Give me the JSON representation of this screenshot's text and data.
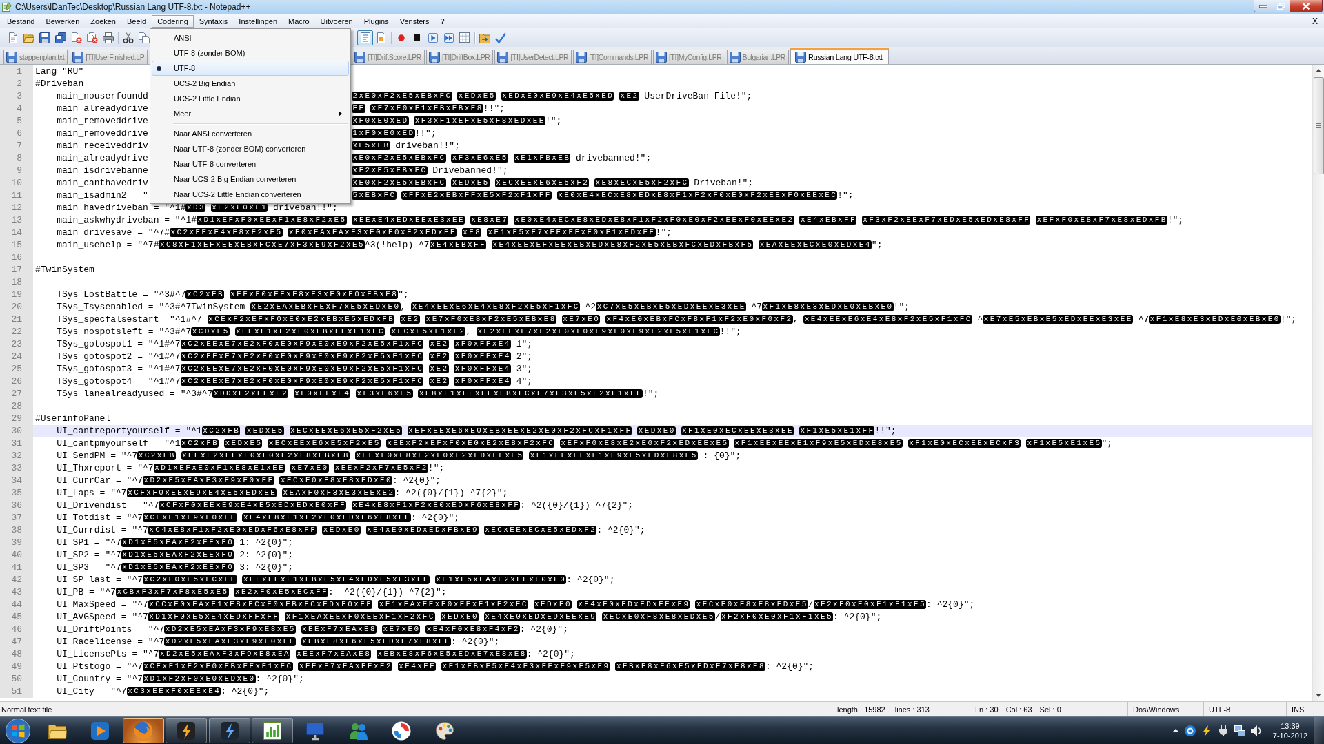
{
  "window": {
    "title": "C:\\Users\\IDanTec\\Desktop\\Russian Lang UTF-8.txt - Notepad++"
  },
  "menu_bar": {
    "items": [
      {
        "label": "Bestand",
        "selected": false
      },
      {
        "label": "Bewerken",
        "selected": false
      },
      {
        "label": "Zoeken",
        "selected": false
      },
      {
        "label": "Beeld",
        "selected": false
      },
      {
        "label": "Codering",
        "selected": true
      },
      {
        "label": "Syntaxis",
        "selected": false
      },
      {
        "label": "Instellingen",
        "selected": false
      },
      {
        "label": "Macro",
        "selected": false
      },
      {
        "label": "Uitvoeren",
        "selected": false
      },
      {
        "label": "Plugins",
        "selected": false
      },
      {
        "label": "Vensters",
        "selected": false
      },
      {
        "label": "?",
        "selected": false
      }
    ],
    "close_label": "X"
  },
  "toolbar": {
    "before_menu": [
      [
        {
          "kind": "new",
          "pressed": false
        },
        {
          "kind": "open",
          "pressed": false
        },
        {
          "kind": "save",
          "pressed": false
        },
        {
          "kind": "save_all",
          "pressed": false
        },
        {
          "kind": "close",
          "pressed": false
        },
        {
          "kind": "close_all",
          "pressed": false
        },
        {
          "kind": "print",
          "pressed": false
        }
      ],
      [
        {
          "kind": "cut",
          "pressed": false
        },
        {
          "kind": "copy",
          "pressed": false
        }
      ]
    ],
    "after_menu": [
      [
        {
          "kind": "wrap",
          "pressed": true
        },
        {
          "kind": "document",
          "pressed": false
        }
      ],
      [
        {
          "kind": "record",
          "pressed": false
        },
        {
          "kind": "stop",
          "pressed": false
        },
        {
          "kind": "play",
          "pressed": false
        },
        {
          "kind": "play_repeat",
          "pressed": false
        },
        {
          "kind": "save_macro",
          "pressed": false
        }
      ],
      [
        {
          "kind": "folder_run",
          "pressed": false
        },
        {
          "kind": "spell_check",
          "pressed": false
        }
      ]
    ]
  },
  "tabs": {
    "before_menu": [
      {
        "label": "stappenplan.txt",
        "selected": false
      },
      {
        "label": "[TI]UserFinished.LP",
        "selected": false
      }
    ],
    "after_menu": [
      {
        "label": "[TI]DriftScore.LPR",
        "selected": false
      },
      {
        "label": "[TI]DriftBox.LPR",
        "selected": false
      },
      {
        "label": "[TI]UserDetect.LPR",
        "selected": false
      },
      {
        "label": "[TI]Commands.LPR",
        "selected": false
      },
      {
        "label": "[TI]MyConfig.LPR",
        "selected": false
      },
      {
        "label": "Bulgarian.LPR",
        "selected": false
      },
      {
        "label": "Russian Lang UTF-8.txt",
        "selected": true
      }
    ]
  },
  "editor": {
    "lines": [
      {
        "number": "1",
        "current": false,
        "segments": [
          {
            "kind": "text",
            "text": "Lang \"RU\""
          }
        ]
      },
      {
        "number": "2",
        "current": false,
        "segments": [
          {
            "kind": "text",
            "text": "#Driveban"
          }
        ]
      },
      {
        "number": "3",
        "current": false,
        "segments": [
          {
            "kind": "text",
            "text": "    main_nouserfoundd"
          }
        ],
        "after_menu": [
          {
            "kind": "bytes",
            "text": "2xE0xF2xE5xEBxFC xEDxE5 xEDxE0xE9xE4xE5xED xE2"
          },
          {
            "kind": "text",
            "text": " UserDriveBan File!\";"
          }
        ]
      },
      {
        "number": "4",
        "current": false,
        "segments": [
          {
            "kind": "text",
            "text": "    main_alreadydrive"
          }
        ],
        "after_menu": [
          {
            "kind": "bytes",
            "text": "EE xE7xE0xE1xFBxEBxE8"
          },
          {
            "kind": "text",
            "text": "!!\";"
          }
        ]
      },
      {
        "number": "5",
        "current": false,
        "segments": [
          {
            "kind": "text",
            "text": "    main_removeddrive"
          }
        ],
        "after_menu": [
          {
            "kind": "bytes",
            "text": "xF0xE0xED xF3xF1xEFxE5xF8xEDxEE"
          },
          {
            "kind": "text",
            "text": "!\";"
          }
        ]
      },
      {
        "number": "6",
        "current": false,
        "segments": [
          {
            "kind": "text",
            "text": "    main_removeddrive"
          }
        ],
        "after_menu": [
          {
            "kind": "bytes",
            "text": "1xF0xE0xED"
          },
          {
            "kind": "text",
            "text": "!!\";"
          }
        ]
      },
      {
        "number": "7",
        "current": false,
        "segments": [
          {
            "kind": "text",
            "text": "    main_receiveddriv"
          }
        ],
        "after_menu": [
          {
            "kind": "bytes",
            "text": "xE5xEB"
          },
          {
            "kind": "text",
            "text": " driveban!!\";"
          }
        ]
      },
      {
        "number": "8",
        "current": false,
        "segments": [
          {
            "kind": "text",
            "text": "    main_alreadydrive"
          }
        ],
        "after_menu": [
          {
            "kind": "bytes",
            "text": "xE0xF2xE5xEBxFC xF3xE6xE5 xE1xFBxEB"
          },
          {
            "kind": "text",
            "text": " drivebanned!\";"
          }
        ]
      },
      {
        "number": "9",
        "current": false,
        "segments": [
          {
            "kind": "text",
            "text": "    main_isdrivebanne"
          }
        ],
        "after_menu": [
          {
            "kind": "bytes",
            "text": "xF2xE5xEBxFC"
          },
          {
            "kind": "text",
            "text": " Drivebanned!\";"
          }
        ]
      },
      {
        "number": "10",
        "current": false,
        "segments": [
          {
            "kind": "text",
            "text": "    main_canthavedriv"
          }
        ],
        "after_menu": [
          {
            "kind": "bytes",
            "text": "xE0xF2xE5xEBxFC xEDxE5 xECxEExE6xE5xF2 xE8xECxE5xF2xFC"
          },
          {
            "kind": "text",
            "text": " Driveban!\";"
          }
        ]
      },
      {
        "number": "11",
        "current": false,
        "segments": [
          {
            "kind": "text",
            "text": "    main_isadmin2 = \""
          }
        ],
        "after_menu": [
          {
            "kind": "bytes",
            "text": "5xEBxFC xFFxE2xEBxFFxE5xF2xF1xFF xE0xE4xECxE8xEDxE8xF1xF2xF0xE0xF2xEExF0xEExEC"
          },
          {
            "kind": "text",
            "text": "!\";"
          }
        ]
      },
      {
        "number": "12",
        "current": false,
        "segments": [
          {
            "kind": "text",
            "text": "    main_havedriveban = \"^1#"
          },
          {
            "kind": "bytes",
            "text": "xD3 xE2xE0xF1"
          },
          {
            "kind": "text",
            "text": " driveban!!\";"
          }
        ]
      },
      {
        "number": "13",
        "current": false,
        "segments": [
          {
            "kind": "text",
            "text": "    main_askwhydriveban = \"^1#"
          },
          {
            "kind": "bytes",
            "text": "xD1xEFxF0xEExF1xE8xF2xE5 xEExE4xEDxEExE3xEE xE8xE7 xE0xE4xECxE8xEDxE8xF1xF2xF0xE0xF2xEExF0xEExE2 xE4xEBxFF xF3xF2xEExF7xEDxE5xEDxE8xFF xEFxF0xE8xF7xE8xEDxFB"
          },
          {
            "kind": "text",
            "text": "!\";"
          }
        ]
      },
      {
        "number": "14",
        "current": false,
        "segments": [
          {
            "kind": "text",
            "text": "    main_drivesave = \"^7#"
          },
          {
            "kind": "bytes",
            "text": "xC2xEExE4xE8xF2xE5 xE0xEAxEAxF3xF0xE0xF2xEDxEE xE8 xE1xE5xE7xEExEFxE0xF1xEDxEE"
          },
          {
            "kind": "text",
            "text": "!\";"
          }
        ]
      },
      {
        "number": "15",
        "current": false,
        "segments": [
          {
            "kind": "text",
            "text": "    main_usehelp = \"^7#"
          },
          {
            "kind": "bytes",
            "text": "xC8xF1xEFxEExEBxFCxE7xF3xE9xF2xE5"
          },
          {
            "kind": "text",
            "text": "^3(!help) ^7"
          },
          {
            "kind": "bytes",
            "text": "xE4xEBxFF xE4xEExEFxEExEBxEDxE8xF2xE5xEBxFCxEDxFBxF5 xEAxEExECxE0xEDxE4"
          },
          {
            "kind": "text",
            "text": "\";"
          }
        ]
      },
      {
        "number": "16",
        "current": false
      },
      {
        "number": "17",
        "current": false,
        "segments": [
          {
            "kind": "text",
            "text": "#TwinSystem"
          }
        ]
      },
      {
        "number": "18",
        "current": false
      },
      {
        "number": "19",
        "current": false,
        "segments": [
          {
            "kind": "text",
            "text": "    TSys_LostBattle = \"^3#^7"
          },
          {
            "kind": "bytes",
            "text": "xC2xFB xEFxF0xEExE8xE3xF0xE0xEBxE8"
          },
          {
            "kind": "text",
            "text": "\";"
          }
        ]
      },
      {
        "number": "20",
        "current": false,
        "segments": [
          {
            "kind": "text",
            "text": "    TSys_Tsysenabled = \"^3#^7TwinSystem "
          },
          {
            "kind": "bytes",
            "text": "xE2xEAxEBxFExF7xE5xEDxE0"
          },
          {
            "kind": "text",
            "text": ", "
          },
          {
            "kind": "bytes",
            "text": "xE4xEExE6xE4xE8xF2xE5xF1xFC"
          },
          {
            "kind": "text",
            "text": " ^2"
          },
          {
            "kind": "bytes",
            "text": "xC7xE5xEBxE5xEDxEExE3xEE"
          },
          {
            "kind": "text",
            "text": " ^7"
          },
          {
            "kind": "bytes",
            "text": "xF1xE8xE3xEDxE0xEBxE0"
          },
          {
            "kind": "text",
            "text": "!\";"
          }
        ]
      },
      {
        "number": "21",
        "current": false,
        "segments": [
          {
            "kind": "text",
            "text": "    TSys_specfalsestart =\"^1#^7 "
          },
          {
            "kind": "bytes",
            "text": "xCExF2xEFxF0xE0xE2xEBxE5xEDxFB xE2 xE7xF0xE8xF2xE5xEBxE8 xE7xE0 xF4xE0xEBxFCxF8xF1xF2xE0xF0xF2"
          },
          {
            "kind": "text",
            "text": ", "
          },
          {
            "kind": "bytes",
            "text": "xE4xEExE6xE4xE8xF2xE5xF1xFC"
          },
          {
            "kind": "text",
            "text": " ^"
          },
          {
            "kind": "bytes",
            "text": "xE7xE5xEBxE5xEDxEExE3xEE"
          },
          {
            "kind": "text",
            "text": " ^7"
          },
          {
            "kind": "bytes",
            "text": "xF1xE8xE3xEDxE0xEBxE0"
          },
          {
            "kind": "text",
            "text": "!\";"
          }
        ]
      },
      {
        "number": "22",
        "current": false,
        "segments": [
          {
            "kind": "text",
            "text": "    TSys_nospotsleft = \"^3#^7"
          },
          {
            "kind": "bytes",
            "text": "xCDxE5 xEExF1xF2xE0xEBxEExF1xFC xECxE5xF1xF2"
          },
          {
            "kind": "text",
            "text": ", "
          },
          {
            "kind": "bytes",
            "text": "xE2xEExE7xE2xF0xE0xF9xE0xE9xF2xE5xF1xFC"
          },
          {
            "kind": "text",
            "text": "!!\";"
          }
        ]
      },
      {
        "number": "23",
        "current": false,
        "segments": [
          {
            "kind": "text",
            "text": "    TSys_gotospot1 = \"^1#^7"
          },
          {
            "kind": "bytes",
            "text": "xC2xEExE7xE2xF0xE0xF9xE0xE9xF2xE5xF1xFC xE2 xF0xFFxE4"
          },
          {
            "kind": "text",
            "text": " 1\";"
          }
        ]
      },
      {
        "number": "24",
        "current": false,
        "segments": [
          {
            "kind": "text",
            "text": "    TSys_gotospot2 = \"^1#^7"
          },
          {
            "kind": "bytes",
            "text": "xC2xEExE7xE2xF0xE0xF9xE0xE9xF2xE5xF1xFC xE2 xF0xFFxE4"
          },
          {
            "kind": "text",
            "text": " 2\";"
          }
        ]
      },
      {
        "number": "25",
        "current": false,
        "segments": [
          {
            "kind": "text",
            "text": "    TSys_gotospot3 = \"^1#^7"
          },
          {
            "kind": "bytes",
            "text": "xC2xEExE7xE2xF0xE0xF9xE0xE9xF2xE5xF1xFC xE2 xF0xFFxE4"
          },
          {
            "kind": "text",
            "text": " 3\";"
          }
        ]
      },
      {
        "number": "26",
        "current": false,
        "segments": [
          {
            "kind": "text",
            "text": "    TSys_gotospot4 = \"^1#^7"
          },
          {
            "kind": "bytes",
            "text": "xC2xEExE7xE2xF0xE0xF9xE0xE9xF2xE5xF1xFC xE2 xF0xFFxE4"
          },
          {
            "kind": "text",
            "text": " 4\";"
          }
        ]
      },
      {
        "number": "27",
        "current": false,
        "segments": [
          {
            "kind": "text",
            "text": "    TSys_lanealreadyused = \"^3#^7"
          },
          {
            "kind": "bytes",
            "text": "xDDxF2xEExF2 xF0xFFxE4 xF3xE6xE5 xE8xF1xEFxEExEBxFCxE7xF3xE5xF2xF1xFF"
          },
          {
            "kind": "text",
            "text": "!\";"
          }
        ]
      },
      {
        "number": "28",
        "current": false
      },
      {
        "number": "29",
        "current": false,
        "segments": [
          {
            "kind": "text",
            "text": "#UserinfoPanel"
          }
        ]
      },
      {
        "number": "30",
        "current": true,
        "segments": [
          {
            "kind": "text",
            "text": "    UI_cantreportyourself = \"^1"
          },
          {
            "kind": "bytes",
            "text": "xC2xFB xEDxE5 xECxEExE6xE5xF2xE5 xEFxEExE6xE0xEBxEExE2xE0xF2xFCxF1xFF xEDxE0 xF1xE0xECxEExE3xEE xF1xE5xE1xFF"
          },
          {
            "kind": "text",
            "text": "!!\";"
          }
        ]
      },
      {
        "number": "31",
        "current": false,
        "segments": [
          {
            "kind": "text",
            "text": "    UI_cantpmyourself = \"^1"
          },
          {
            "kind": "bytes",
            "text": "xC2xFB xEDxE5 xECxEExE6xE5xF2xE5 xEExF2xEFxF0xE0xE2xE8xF2xFC xEFxF0xE8xE2xE0xF2xEDxEExE5 xF1xEExEExE1xF9xE5xEDxE8xE5 xF1xE0xECxEExECxF3 xF1xE5xE1xE5"
          },
          {
            "kind": "text",
            "text": "\";"
          }
        ]
      },
      {
        "number": "32",
        "current": false,
        "segments": [
          {
            "kind": "text",
            "text": "    UI_SendPM = \"^7"
          },
          {
            "kind": "bytes",
            "text": "xC2xFB xEExF2xEFxF0xE0xE2xE8xEBxE8 xEFxF0xE8xE2xE0xF2xEDxEExE5 xF1xEExEExE1xF9xE5xEDxE8xE5"
          },
          {
            "kind": "text",
            "text": " : {0}\";"
          }
        ]
      },
      {
        "number": "33",
        "current": false,
        "segments": [
          {
            "kind": "text",
            "text": "    UI_Thxreport = \"^7"
          },
          {
            "kind": "bytes",
            "text": "xD1xEFxE0xF1xE8xE1xEE xE7xE0 xEExF2xF7xE5xF2"
          },
          {
            "kind": "text",
            "text": "!\";"
          }
        ]
      },
      {
        "number": "34",
        "current": false,
        "segments": [
          {
            "kind": "text",
            "text": "    UI_CurrCar = \"^7"
          },
          {
            "kind": "bytes",
            "text": "xD2xE5xEAxF3xF9xE0xFF xECxE0xF8xE8xEDxE0"
          },
          {
            "kind": "text",
            "text": ": ^2{0}\";"
          }
        ]
      },
      {
        "number": "35",
        "current": false,
        "segments": [
          {
            "kind": "text",
            "text": "    UI_Laps = \"^7"
          },
          {
            "kind": "bytes",
            "text": "xCFxF0xEExE9xE4xE5xEDxEE xEAxF0xF3xE3xEExE2"
          },
          {
            "kind": "text",
            "text": ": ^2({0}/{1}) ^7{2}\";"
          }
        ]
      },
      {
        "number": "36",
        "current": false,
        "segments": [
          {
            "kind": "text",
            "text": "    UI_Drivendist = \"^7"
          },
          {
            "kind": "bytes",
            "text": "xCFxF0xEExE9xE4xE5xEDxEDxE0xFF xE4xE8xF1xF2xE0xEDxF6xE8xFF"
          },
          {
            "kind": "text",
            "text": ": ^2({0}/{1}) ^7{2}\";"
          }
        ]
      },
      {
        "number": "37",
        "current": false,
        "segments": [
          {
            "kind": "text",
            "text": "    UI_Totdist = \"^7"
          },
          {
            "kind": "bytes",
            "text": "xCExE1xF9xE0xFF xE4xE8xF1xF2xE0xEDxF6xE8xFF"
          },
          {
            "kind": "text",
            "text": ": ^2{0}\";"
          }
        ]
      },
      {
        "number": "38",
        "current": false,
        "segments": [
          {
            "kind": "text",
            "text": "    UI_Currdist = \"^7"
          },
          {
            "kind": "bytes",
            "text": "xC4xE8xF1xF2xE0xEDxF6xE8xFF xEDxE0 xE4xE0xEDxEDxFBxE9 xECxEExECxE5xEDxF2"
          },
          {
            "kind": "text",
            "text": ": ^2{0}\";"
          }
        ]
      },
      {
        "number": "39",
        "current": false,
        "segments": [
          {
            "kind": "text",
            "text": "    UI_SP1 = \"^7"
          },
          {
            "kind": "bytes",
            "text": "xD1xE5xEAxF2xEExF0"
          },
          {
            "kind": "text",
            "text": " 1: ^2{0}\";"
          }
        ]
      },
      {
        "number": "40",
        "current": false,
        "segments": [
          {
            "kind": "text",
            "text": "    UI_SP2 = \"^7"
          },
          {
            "kind": "bytes",
            "text": "xD1xE5xEAxF2xEExF0"
          },
          {
            "kind": "text",
            "text": " 2: ^2{0}\";"
          }
        ]
      },
      {
        "number": "41",
        "current": false,
        "segments": [
          {
            "kind": "text",
            "text": "    UI_SP3 = \"^7"
          },
          {
            "kind": "bytes",
            "text": "xD1xE5xEAxF2xEExF0"
          },
          {
            "kind": "text",
            "text": " 3: ^2{0}\";"
          }
        ]
      },
      {
        "number": "42",
        "current": false,
        "segments": [
          {
            "kind": "text",
            "text": "    UI_SP_last = \"^7"
          },
          {
            "kind": "bytes",
            "text": "xC2xF0xE5xECxFF xEFxEExF1xEBxE5xE4xEDxE5xE3xEE xF1xE5xEAxF2xEExF0xE0"
          },
          {
            "kind": "text",
            "text": ": ^2{0}\";"
          }
        ]
      },
      {
        "number": "43",
        "current": false,
        "segments": [
          {
            "kind": "text",
            "text": "    UI_PB = \"^7"
          },
          {
            "kind": "bytes",
            "text": "xCBxF3xF7xF8xE5xE5 xE2xF0xE5xECxFF"
          },
          {
            "kind": "text",
            "text": ":  ^2({0}/{1}) ^7{2}\";"
          }
        ]
      },
      {
        "number": "44",
        "current": false,
        "segments": [
          {
            "kind": "text",
            "text": "    UI_MaxSpeed = \"^7"
          },
          {
            "kind": "bytes",
            "text": "xCCxE0xEAxF1xE8xECxE0xEBxFCxEDxE0xFF xF1xEAxEExF0xEExF1xF2xFC xEDxE0 xE4xE0xEDxEDxEExE9 xECxE0xF8xE8xEDxE5"
          },
          {
            "kind": "text",
            "text": "/"
          },
          {
            "kind": "bytes",
            "text": "xF2xF0xE0xF1xF1xE5"
          },
          {
            "kind": "text",
            "text": ": ^2{0}\";"
          }
        ]
      },
      {
        "number": "45",
        "current": false,
        "segments": [
          {
            "kind": "text",
            "text": "    UI_AVGSpeed = \"^7"
          },
          {
            "kind": "bytes",
            "text": "xD1xF0xE5xE4xEDxFFxFF xF1xEAxEExF0xEExF1xF2xFC xEDxE0 xE4xE0xEDxEDxEExE9 xECxE0xF8xE8xEDxE5"
          },
          {
            "kind": "text",
            "text": "/"
          },
          {
            "kind": "bytes",
            "text": "xF2xF0xE0xF1xF1xE5"
          },
          {
            "kind": "text",
            "text": ": ^2{0}\";"
          }
        ]
      },
      {
        "number": "46",
        "current": false,
        "segments": [
          {
            "kind": "text",
            "text": "    UI_DriftPoints = \"^7"
          },
          {
            "kind": "bytes",
            "text": "xD2xE5xEAxF3xF9xE8xE5 xEExF7xEAxE8 xE7xE0 xE4xF0xE8xF4xF2"
          },
          {
            "kind": "text",
            "text": ": ^2{0}\";"
          }
        ]
      },
      {
        "number": "47",
        "current": false,
        "segments": [
          {
            "kind": "text",
            "text": "    UI_Racelicense = \"^7"
          },
          {
            "kind": "bytes",
            "text": "xD2xE5xEAxF3xF9xE0xFF xEBxE8xF6xE5xEDxE7xE8xFF"
          },
          {
            "kind": "text",
            "text": ": ^2{0}\";"
          }
        ]
      },
      {
        "number": "48",
        "current": false,
        "segments": [
          {
            "kind": "text",
            "text": "    UI_LicensePts = \"^7"
          },
          {
            "kind": "bytes",
            "text": "xD2xE5xEAxF3xF9xE8xEA xEExF7xEAxE8 xEBxE8xF6xE5xEDxE7xE8xE8"
          },
          {
            "kind": "text",
            "text": ": ^2{0}\";"
          }
        ]
      },
      {
        "number": "49",
        "current": false,
        "segments": [
          {
            "kind": "text",
            "text": "    UI_Ptstogo = \"^7"
          },
          {
            "kind": "bytes",
            "text": "xCExF1xF2xE0xEBxEExF1xFC xEExF7xEAxEExE2 xE4xEE xF1xEBxE5xE4xF3xFExF9xE5xE9 xEBxE8xF6xE5xEDxE7xE8xE8"
          },
          {
            "kind": "text",
            "text": ": ^2{0}\";"
          }
        ]
      },
      {
        "number": "50",
        "current": false,
        "segments": [
          {
            "kind": "text",
            "text": "    UI_Country = \"^7"
          },
          {
            "kind": "bytes",
            "text": "xD1xF2xF0xE0xEDxE0"
          },
          {
            "kind": "text",
            "text": ": ^2{0}\";"
          }
        ]
      },
      {
        "number": "51",
        "current": false,
        "segments": [
          {
            "kind": "text",
            "text": "    UI_City = \"^7"
          },
          {
            "kind": "bytes",
            "text": "xC3xEExF0xEExE4"
          },
          {
            "kind": "text",
            "text": ": ^2{0}\";"
          }
        ]
      }
    ]
  },
  "encoding_menu": {
    "items": [
      {
        "kind": "item",
        "label": "ANSI",
        "checked": false,
        "selected": false
      },
      {
        "kind": "item",
        "label": "UTF-8 (zonder BOM)",
        "checked": false,
        "selected": false
      },
      {
        "kind": "item",
        "label": "UTF-8",
        "checked": true,
        "selected": true
      },
      {
        "kind": "item",
        "label": "UCS-2 Big Endian",
        "checked": false,
        "selected": false
      },
      {
        "kind": "item",
        "label": "UCS-2 Little Endian",
        "checked": false,
        "selected": false
      },
      {
        "kind": "submenu",
        "label": "Meer",
        "checked": false,
        "selected": false
      },
      {
        "kind": "separator"
      },
      {
        "kind": "item",
        "label": "Naar ANSI converteren",
        "checked": false,
        "selected": false
      },
      {
        "kind": "item",
        "label": "Naar UTF-8 (zonder BOM) converteren",
        "checked": false,
        "selected": false
      },
      {
        "kind": "item",
        "label": "Naar UTF-8 converteren",
        "checked": false,
        "selected": false
      },
      {
        "kind": "item",
        "label": "Naar UCS-2 Big Endian converteren",
        "checked": false,
        "selected": false
      },
      {
        "kind": "item",
        "label": "Naar UCS-2 Little Endian converteren",
        "checked": false,
        "selected": false
      }
    ]
  },
  "status_bar": {
    "file_type": "Normal text file",
    "length": "length : 15982",
    "lines": "lines : 313",
    "line": "Ln : 30",
    "column": "Col : 63",
    "selection": "Sel : 0",
    "eol": "Dos\\Windows",
    "encoding": "UTF-8",
    "mode": "INS"
  },
  "taskbar": {
    "apps": [
      {
        "kind": "folder",
        "running": false,
        "highlighted": false
      },
      {
        "kind": "media",
        "running": false,
        "highlighted": false
      },
      {
        "kind": "browser",
        "running": true,
        "highlighted": true
      },
      {
        "kind": "bolt_orange",
        "running": true,
        "highlighted": false
      },
      {
        "kind": "bolt_blue",
        "running": true,
        "highlighted": false
      },
      {
        "kind": "chart",
        "running": true,
        "highlighted": false
      },
      {
        "kind": "monitor",
        "running": false,
        "highlighted": false
      },
      {
        "kind": "people",
        "running": false,
        "highlighted": false
      },
      {
        "kind": "disc",
        "running": false,
        "highlighted": false
      },
      {
        "kind": "palette",
        "running": false,
        "highlighted": false
      }
    ],
    "clock": {
      "time": "13:39",
      "date": "7-10-2012"
    }
  }
}
